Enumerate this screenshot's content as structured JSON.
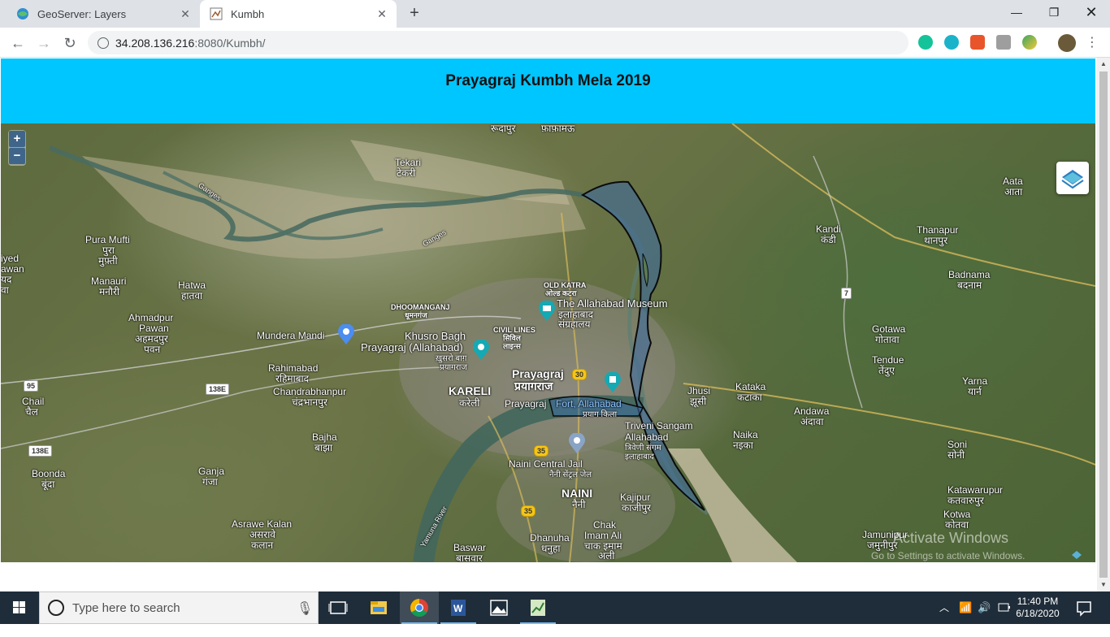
{
  "browser": {
    "tabs": [
      {
        "title": "GeoServer: Layers"
      },
      {
        "title": "Kumbh"
      }
    ],
    "address": {
      "host": "34.208.136.216",
      "rest": ":8080/Kumbh/"
    }
  },
  "page": {
    "title": "Prayagraj Kumbh Mela 2019",
    "zoom_in": "+",
    "zoom_out": "−"
  },
  "map_labels": {
    "ganges": "Ganges",
    "tekari": "Tekari",
    "tekari_hi": "टेकरी",
    "rudrapur": "रूदापुर",
    "fafamau": "फ़ाफ़ामऊ",
    "pura_mufti": "Pura Mufti",
    "pura_mufti_hi": "पुरा",
    "mufti_hi": "मुफ़्ती",
    "manauri": "Manauri",
    "manauri_hi": "मनौरी",
    "hatwa": "Hatwa",
    "hatwa_hi": "हातवा",
    "ahmadpur": "Ahmadpur",
    "pawan": "Pawan",
    "ahmadpur_hi": "अहमदपुर",
    "pawan_hi": "पवन",
    "mundera_mandi": "Mundera Mandi",
    "rahimabad": "Rahimabad",
    "rahimabad_hi": "रहिमाबाद",
    "chandrabhanpur": "Chandrabhanpur",
    "chandrabhanpur_hi": "चंद्रभानपुर",
    "chail": "Chail",
    "chail_hi": "चैल",
    "bajha": "Bajha",
    "bajha_hi": "बाझा",
    "boonda": "Boonda",
    "boonda_hi": "बूंदा",
    "ganja": "Ganja",
    "ganja_hi": "गंजा",
    "asrawe": "Asrawe Kalan",
    "asrawe_hi": "असरावे",
    "asrawe_hi2": "कलान",
    "dhoomanganj": "DHOOMANGANJ",
    "dhoomanganj_hi": "धूमनगंज",
    "old_katra": "OLD KATRA",
    "old_katra_hi": "ओल्ड कटरा",
    "museum": "The Allahabad Museum",
    "museum_hi": "इलाहाबाद",
    "museum_hi2": "संग्रहालय",
    "khusro": "Khusro Bagh",
    "prayagraj_allahabad": "Prayagraj (Allahabad)",
    "khusro_hi": "ख़ुसरो बाग़",
    "prayagraj_hi_small": "प्रयागराज",
    "civil_lines": "CIVIL LINES",
    "civil_hi": "सिविल",
    "lines_hi": "लाइन्स",
    "prayagraj": "Prayagraj",
    "prayagraj_hi": "प्रयागराज",
    "kareli": "KARELI",
    "kareli_hi": "करेली",
    "prayagraj_fort": "Prayagraj",
    "fort": "Fort, Allahabad",
    "fort_hi": "प्रयाग किला",
    "triveni": "Triveni Sangam",
    "triveni2": "Allahabad",
    "triveni_hi": "त्रिवेणी संगम",
    "triveni_hi2": "इलाहाबाद",
    "jhusi": "Jhusi",
    "jhusi_hi": "झूसी",
    "naini_jail": "Naini Central Jail",
    "naini_jail_hi": "नैनी सेंट्रल जेल",
    "naini": "NAINI",
    "naini_hi": "नैनी",
    "kajipur": "Kajipur",
    "kajipur_hi": "काजीपुर",
    "chak": "Chak",
    "imam_ali": "Imam Ali",
    "chak_hi": "चाक इमाम",
    "ali_hi": "अली",
    "dhanuha": "Dhanuha",
    "dhanuha_hi": "धनुहा",
    "baswar": "Baswar",
    "baswar_hi": "बासवार",
    "yamuna": "Yamuna River",
    "kandi": "Kandi",
    "kandi_hi": "कंडी",
    "thanapur": "Thanapur",
    "thanapur_hi": "थानपुर",
    "aata": "Aata",
    "aata_hi": "आता",
    "badnama": "Badnama",
    "badnama_hi": "बदनाम",
    "gotawa": "Gotawa",
    "gotawa_hi": "गोतावा",
    "tendue": "Tendue",
    "tendue_hi": "तेंदुए",
    "yarna": "Yarna",
    "yarna_hi": "यार्न",
    "kataka": "Kataka",
    "kataka_hi": "कटाका",
    "andawa": "Andawa",
    "andawa_hi": "अंदावा",
    "naika": "Naika",
    "naika_hi": "नइका",
    "soni": "Soni",
    "soni_hi": "सोनी",
    "katawarupur": "Katawarupur",
    "katawarupur_hi": "कतवारुपुर",
    "kotwa": "Kotwa",
    "kotwa_hi": "कोतवा",
    "jamunipur": "Jamunipur",
    "jamunipur_hi": "जमुनीपुर",
    "left1": "iyed",
    "left2": "awan",
    "left3": "यद",
    "left4": "वा",
    "shield_95": "95",
    "shield_138e_1": "138E",
    "shield_138e_2": "138E",
    "shield_30": "30",
    "shield_35a": "35",
    "shield_35b": "35",
    "shield_7": "7",
    "watermark1": "Activate Windows",
    "watermark2": "Go to Settings to activate Windows."
  },
  "taskbar": {
    "search_placeholder": "Type here to search",
    "time": "11:40 PM",
    "date": "6/18/2020"
  },
  "colors": {
    "banner": "#00c6ff",
    "overlay_fill": "#3f6d9e",
    "overlay_stroke": "#0b0b0b"
  }
}
